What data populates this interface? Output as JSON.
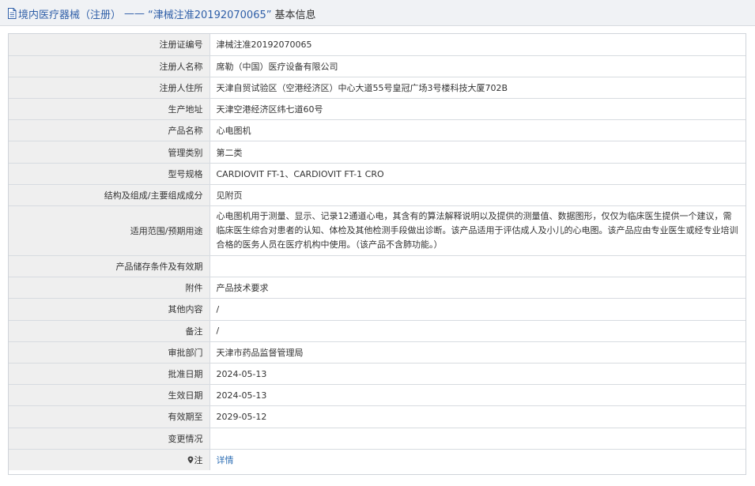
{
  "header": {
    "prefix": "境内医疗器械（注册）",
    "separator": "——",
    "reg_number_quoted": "“津械注准20192070065”",
    "suffix": "基本信息"
  },
  "rows": [
    {
      "label": "注册证编号",
      "value": "津械注准20192070065"
    },
    {
      "label": "注册人名称",
      "value": "席勒（中国）医疗设备有限公司"
    },
    {
      "label": "注册人住所",
      "value": "天津自贸试验区（空港经济区）中心大道55号皇冠广场3号楼科技大厦702B"
    },
    {
      "label": "生产地址",
      "value": "天津空港经济区纬七道60号"
    },
    {
      "label": "产品名称",
      "value": "心电图机"
    },
    {
      "label": "管理类别",
      "value": "第二类"
    },
    {
      "label": "型号规格",
      "value": "CARDIOVIT FT-1、CARDIOVIT FT-1 CRO"
    },
    {
      "label": "结构及组成/主要组成成分",
      "value": "见附页"
    },
    {
      "label": "适用范围/预期用途",
      "value": "心电图机用于测量、显示、记录12通道心电，其含有的算法解释说明以及提供的测量值、数据图形，仅仅为临床医生提供一个建议，需临床医生综合对患者的认知、体检及其他检测手段做出诊断。该产品适用于评估成人及小儿的心电图。该产品应由专业医生或经专业培训合格的医务人员在医疗机构中使用。（该产品不含肺功能。）"
    },
    {
      "label": "产品储存条件及有效期",
      "value": ""
    },
    {
      "label": "附件",
      "value": "产品技术要求"
    },
    {
      "label": "其他内容",
      "value": "/"
    },
    {
      "label": "备注",
      "value": "/"
    },
    {
      "label": "审批部门",
      "value": "天津市药品监督管理局"
    },
    {
      "label": "批准日期",
      "value": "2024-05-13"
    },
    {
      "label": "生效日期",
      "value": "2024-05-13"
    },
    {
      "label": "有效期至",
      "value": "2029-05-12"
    },
    {
      "label": "变更情况",
      "value": ""
    }
  ],
  "note": {
    "label": "注",
    "link": "详情"
  }
}
